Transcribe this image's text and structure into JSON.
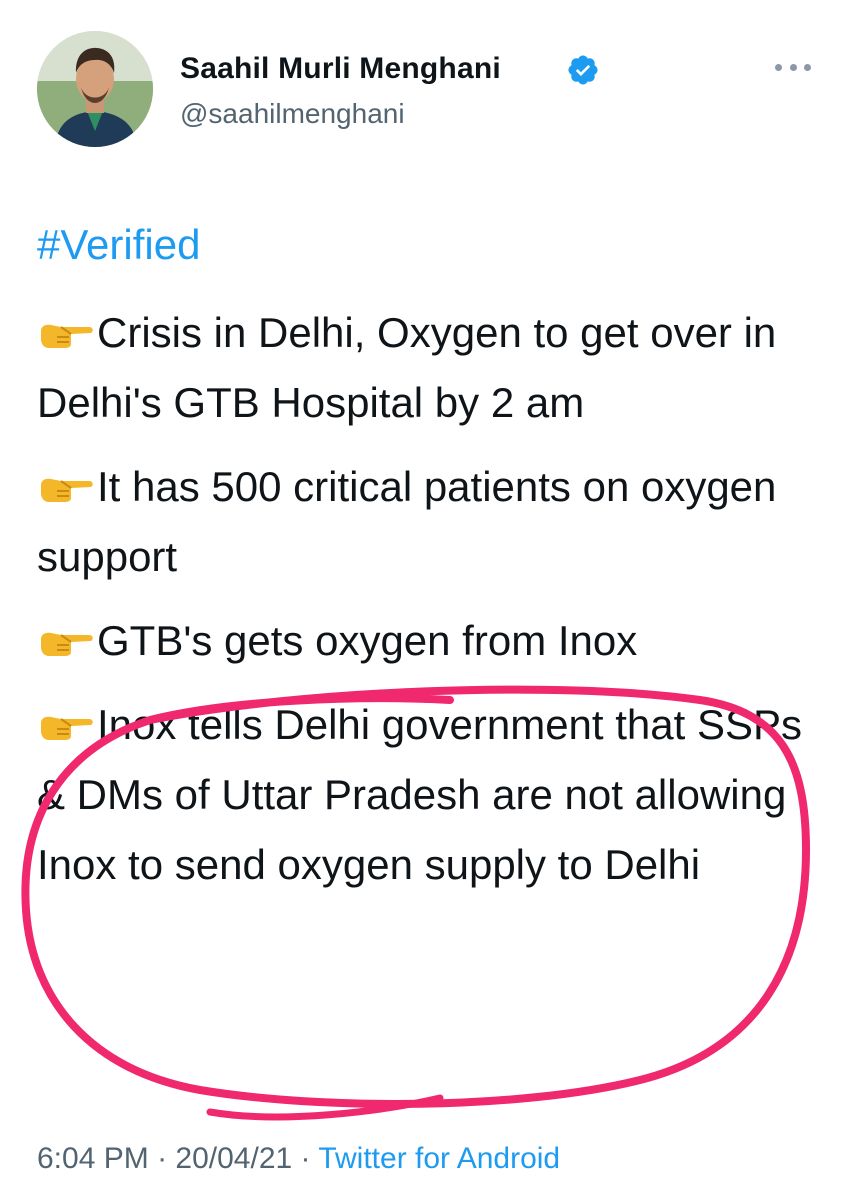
{
  "author": {
    "display_name": "Saahil Murli Menghani",
    "handle": "@saahilmenghani",
    "verified": true
  },
  "icons": {
    "verified": "verified-badge-icon",
    "more": "more-options-icon",
    "point": "backhand-index-pointing-right-emoji"
  },
  "tweet": {
    "hashtag": "#Verified",
    "points": [
      "Crisis in Delhi, Oxygen to get over in Delhi's GTB Hospital by 2 am",
      "It has 500 critical patients on oxygen support",
      "GTB's gets oxygen from Inox",
      "Inox tells Delhi government that SSPs & DMs of Uttar Pradesh are not allowing Inox to send oxygen supply to Delhi"
    ]
  },
  "meta": {
    "time": "6:04 PM",
    "separator": "·",
    "date": "20/04/21",
    "source": "Twitter for Android"
  },
  "colors": {
    "link": "#1d9bf0",
    "secondary_text": "#536471",
    "annotation": "#f0286e",
    "emoji": "#f4b72a"
  }
}
